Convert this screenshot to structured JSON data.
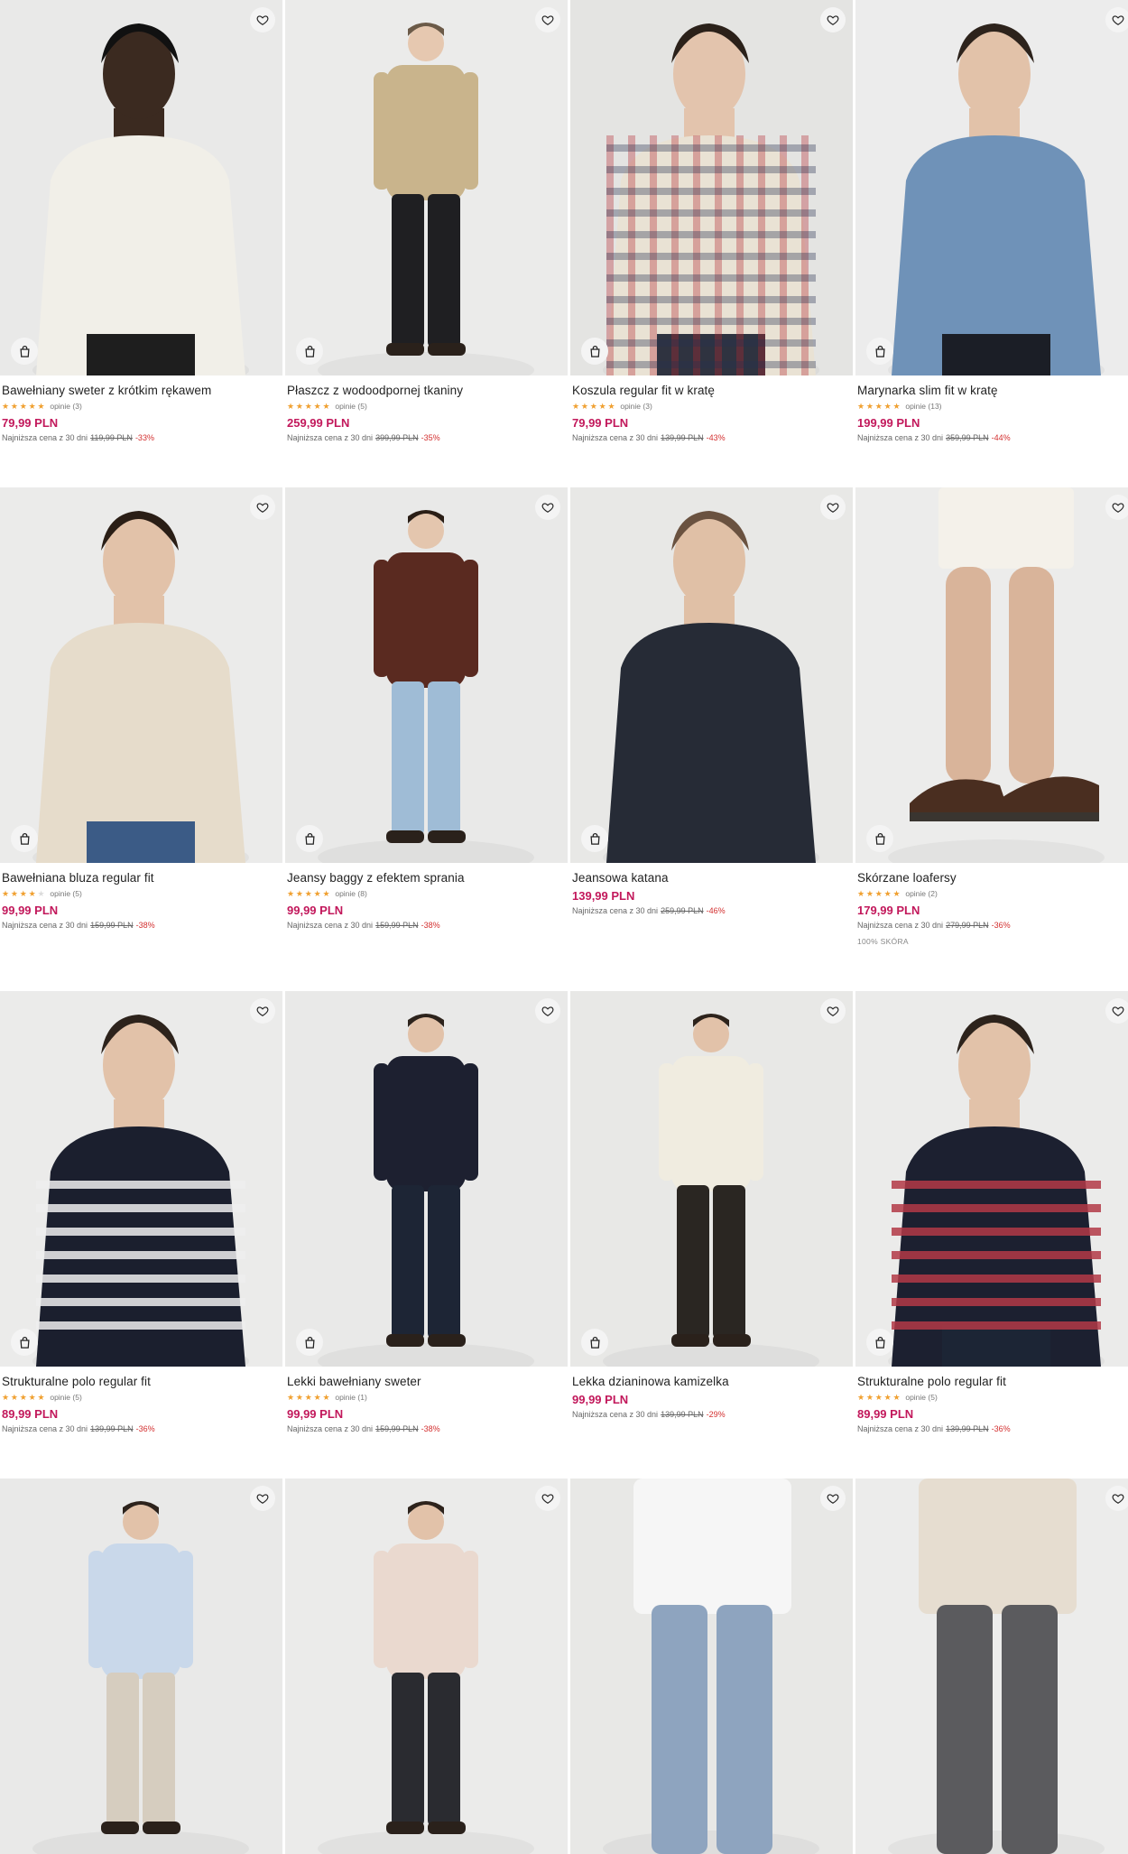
{
  "products": [
    {
      "name": "Bawełniany sweter z krótkim rękawem",
      "stars": 5,
      "reviews": "opinie (3)",
      "price": "79,99 PLN",
      "lowest_label": "Najniższa cena z 30 dni",
      "old_price": "119,99 PLN",
      "discount": "-33%",
      "bg": "#e9e9e8",
      "top": "#f1efe8",
      "bottom": "#1e1e1e",
      "skin": "#3b2a20",
      "hair": "#111111"
    },
    {
      "name": "Płaszcz z wodoodpornej tkaniny",
      "stars": 5,
      "reviews": "opinie (5)",
      "price": "259,99 PLN",
      "lowest_label": "Najniższa cena z 30 dni",
      "old_price": "399,99 PLN",
      "discount": "-35%",
      "bg": "#ebebea",
      "top": "#c9b48c",
      "bottom": "#1f1f22",
      "skin": "#e6c8b0",
      "hair": "#6b5a48"
    },
    {
      "name": "Koszula regular fit w kratę",
      "stars": 5,
      "reviews": "opinie (3)",
      "price": "79,99 PLN",
      "lowest_label": "Najniższa cena z 30 dni",
      "old_price": "139,99 PLN",
      "discount": "-43%",
      "bg": "#e4e4e2",
      "top": "#e9e2d4",
      "bottom": "#2f3340",
      "skin": "#e3c4ad",
      "hair": "#2b211a"
    },
    {
      "name": "Marynarka slim fit w kratę",
      "stars": 5,
      "reviews": "opinie (13)",
      "price": "199,99 PLN",
      "lowest_label": "Najniższa cena z 30 dni",
      "old_price": "359,99 PLN",
      "discount": "-44%",
      "bg": "#ececec",
      "top": "#6f92b8",
      "bottom": "#1b1e26",
      "skin": "#e2c2a9",
      "hair": "#2d231c"
    },
    {
      "name": "Bawełniana bluza regular fit",
      "stars": 4,
      "reviews": "opinie (5)",
      "price": "99,99 PLN",
      "lowest_label": "Najniższa cena z 30 dni",
      "old_price": "159,99 PLN",
      "discount": "-38%",
      "bg": "#ebebea",
      "top": "#e6dccb",
      "bottom": "#3b5b86",
      "skin": "#e2c2a9",
      "hair": "#2a1e16"
    },
    {
      "name": "Jeansy baggy z efektem sprania",
      "stars": 5,
      "reviews": "opinie (8)",
      "price": "99,99 PLN",
      "lowest_label": "Najniższa cena z 30 dni",
      "old_price": "159,99 PLN",
      "discount": "-38%",
      "bg": "#e9e9e8",
      "top": "#5a2a20",
      "bottom": "#9fbcd6",
      "skin": "#e4c6ae",
      "hair": "#2a1e16"
    },
    {
      "name": "Jeansowa katana",
      "stars": 0,
      "reviews": "",
      "price": "139,99 PLN",
      "lowest_label": "Najniższa cena z 30 dni",
      "old_price": "259,99 PLN",
      "discount": "-46%",
      "bg": "#e8e8e6",
      "top": "#262b36",
      "bottom": "#262b36",
      "skin": "#e0c0a6",
      "hair": "#6a5240"
    },
    {
      "name": "Skórzane loafersy",
      "stars": 5,
      "reviews": "opinie (2)",
      "price": "179,99 PLN",
      "lowest_label": "Najniższa cena z 30 dni",
      "old_price": "279,99 PLN",
      "discount": "-36%",
      "material": "100% SKÓRA",
      "bg": "#ececeb",
      "top": "#f4f1ea",
      "bottom": "#f4f1ea",
      "skin": "#d9b49a",
      "hair": "#5a3a26"
    },
    {
      "name": "Strukturalne polo regular fit",
      "stars": 5,
      "reviews": "opinie (5)",
      "price": "89,99 PLN",
      "lowest_label": "Najniższa cena z 30 dni",
      "old_price": "139,99 PLN",
      "discount": "-36%",
      "bg": "#ebebea",
      "top": "#1b1f2e",
      "bottom": "#1b1f2e",
      "skin": "#e2c2a9",
      "hair": "#2d231c"
    },
    {
      "name": "Lekki bawełniany sweter",
      "stars": 5,
      "reviews": "opinie (1)",
      "price": "99,99 PLN",
      "lowest_label": "Najniższa cena z 30 dni",
      "old_price": "159,99 PLN",
      "discount": "-38%",
      "bg": "#e9e9e8",
      "top": "#1d2030",
      "bottom": "#1d2535",
      "skin": "#e2c2a9",
      "hair": "#2d231c"
    },
    {
      "name": "Lekka dzianinowa kamizelka",
      "stars": 0,
      "reviews": "",
      "price": "99,99 PLN",
      "lowest_label": "Najniższa cena z 30 dni",
      "old_price": "139,99 PLN",
      "discount": "-29%",
      "bg": "#e8e8e6",
      "top": "#f0ece0",
      "bottom": "#2a2622",
      "skin": "#e2c2a9",
      "hair": "#2d231c"
    },
    {
      "name": "Strukturalne polo regular fit",
      "stars": 5,
      "reviews": "opinie (5)",
      "price": "89,99 PLN",
      "lowest_label": "Najniższa cena z 30 dni",
      "old_price": "139,99 PLN",
      "discount": "-36%",
      "bg": "#ebebea",
      "top": "#1c2030",
      "bottom": "#1c2535",
      "skin": "#e2c2a9",
      "hair": "#2d231c"
    },
    {
      "name": "",
      "stars": 0,
      "reviews": "",
      "price": "",
      "bg": "#e9e9e8",
      "top": "#c9d8ea",
      "bottom": "#d6cdbf",
      "skin": "#e2c2a9",
      "hair": "#2d231c"
    },
    {
      "name": "",
      "stars": 0,
      "reviews": "",
      "price": "",
      "bg": "#ebebea",
      "top": "#ead9cf",
      "bottom": "#2a2b30",
      "skin": "#e2c2a9",
      "hair": "#2d231c"
    },
    {
      "name": "",
      "stars": 0,
      "reviews": "",
      "price": "",
      "bg": "#e8e8e6",
      "top": "#f6f6f6",
      "bottom": "#8ea4bf",
      "skin": "#e2c2a9",
      "hair": "#2d231c"
    },
    {
      "name": "",
      "stars": 0,
      "reviews": "",
      "price": "",
      "bg": "#ececeb",
      "top": "#e6ddd0",
      "bottom": "#5b5b5e",
      "skin": "#e2c2a9",
      "hair": "#2d231c"
    }
  ],
  "icons": {
    "favorite": "heart-icon",
    "bag": "shopping-bag-icon",
    "star": "star-icon"
  }
}
